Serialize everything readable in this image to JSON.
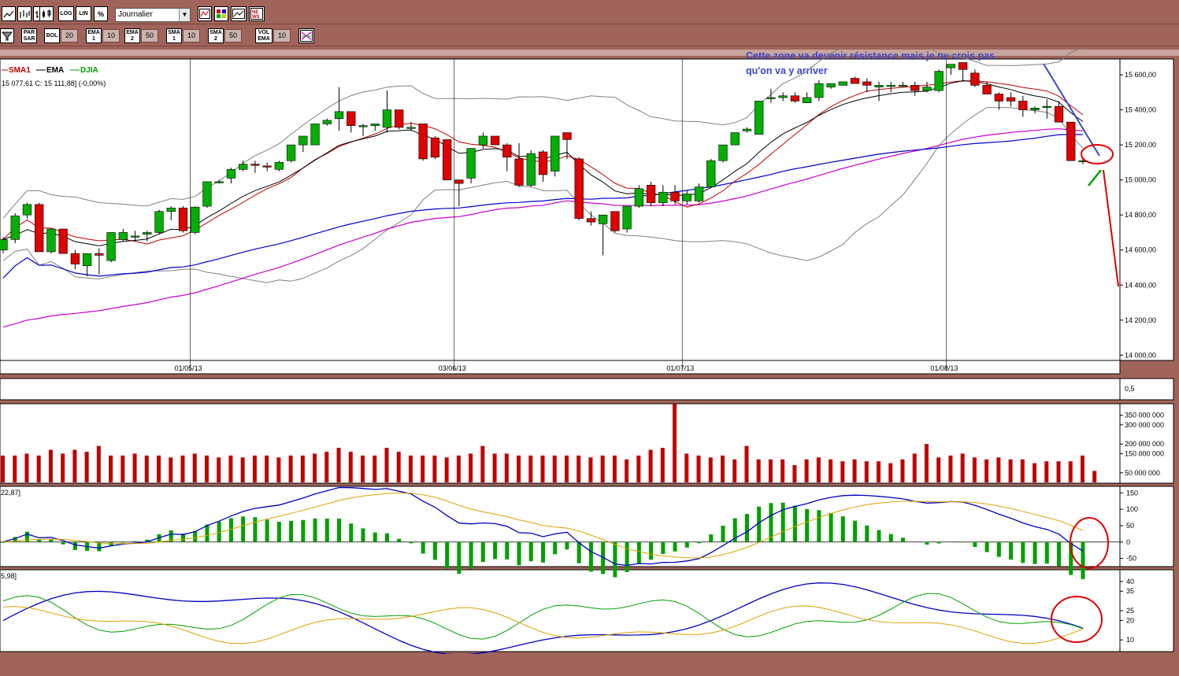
{
  "toolbar1": {
    "buttons": [
      {
        "id": "line-chart-button",
        "label": ""
      },
      {
        "id": "bar-chart-button",
        "label": ""
      },
      {
        "id": "ohlc-chart-button",
        "label": ""
      },
      {
        "id": "candle-chart-button",
        "label": ""
      },
      {
        "id": "log-button",
        "label": "LOG"
      },
      {
        "id": "lin-button",
        "label": "LIN"
      },
      {
        "id": "percent-button",
        "label": "%"
      }
    ],
    "period_select": "Journalier"
  },
  "toolbar2": {
    "indicators": [
      {
        "label": "PAR SAR",
        "value": ""
      },
      {
        "label": "BOL",
        "value": "20"
      },
      {
        "label": "EMA 1",
        "value": "10"
      },
      {
        "label": "EMA 2",
        "value": "50"
      },
      {
        "label": "SMA 1",
        "value": "10"
      },
      {
        "label": "SMA 2",
        "value": "50"
      },
      {
        "label": "VOL EMA",
        "value": "10"
      }
    ]
  },
  "legend": {
    "sma": "SMA1",
    "ema": "EMA",
    "djia": "DJIA"
  },
  "price_info": "15 077,61  C: 15 111,88] (-0,00%)",
  "annotation": {
    "line1": "Cette zone va devenir résistance mais je ne crois pas",
    "line2": "qu'on va y arriver"
  },
  "macd_info": "22,87]",
  "dmi_info": "5,98]",
  "colors": {
    "up": "#00b000",
    "down": "#e00000",
    "volume": "#c00000",
    "annotation": "#3a48c8",
    "ema50": "#cc00cc",
    "sma50": "#0000cc",
    "bollinger": "#808080"
  },
  "chart_data": {
    "type": "candlestick",
    "y_ticks": [
      "15 600,00",
      "15 400,00",
      "15 200,00",
      "15 000,00",
      "14 800,00",
      "14 600,00",
      "14 400,00",
      "14 200,00",
      "14 000,00"
    ],
    "ylim": [
      13970,
      15690
    ],
    "x_ticks": [
      {
        "label": "01/05/13",
        "index": 16
      },
      {
        "label": "03/06/13",
        "index": 38
      },
      {
        "label": "01/07/13",
        "index": 57
      },
      {
        "label": "01/08/13",
        "index": 79
      }
    ],
    "candles": [
      [
        14600,
        14675,
        14580,
        14660
      ],
      [
        14660,
        14810,
        14640,
        14795
      ],
      [
        14800,
        14870,
        14780,
        14860
      ],
      [
        14860,
        14870,
        14590,
        14590
      ],
      [
        14590,
        14720,
        14580,
        14720
      ],
      [
        14720,
        14720,
        14580,
        14580
      ],
      [
        14580,
        14600,
        14490,
        14520
      ],
      [
        14510,
        14580,
        14450,
        14580
      ],
      [
        14580,
        14610,
        14460,
        14570
      ],
      [
        14540,
        14700,
        14530,
        14700
      ],
      [
        14660,
        14720,
        14650,
        14700
      ],
      [
        14680,
        14710,
        14650,
        14680
      ],
      [
        14690,
        14710,
        14650,
        14700
      ],
      [
        14700,
        14830,
        14690,
        14820
      ],
      [
        14820,
        14850,
        14770,
        14840
      ],
      [
        14840,
        14850,
        14700,
        14710
      ],
      [
        14700,
        14850,
        14690,
        14845
      ],
      [
        14850,
        14980,
        14840,
        14990
      ],
      [
        14990,
        15000,
        14980,
        14990
      ],
      [
        15010,
        15070,
        14980,
        15060
      ],
      [
        15060,
        15110,
        15050,
        15090
      ],
      [
        15090,
        15110,
        15040,
        15085
      ],
      [
        15080,
        15100,
        15050,
        15075
      ],
      [
        15060,
        15110,
        15050,
        15100
      ],
      [
        15110,
        15190,
        15100,
        15200
      ],
      [
        15200,
        15230,
        15160,
        15250
      ],
      [
        15200,
        15320,
        15200,
        15320
      ],
      [
        15320,
        15350,
        15310,
        15340
      ],
      [
        15350,
        15530,
        15280,
        15390
      ],
      [
        15390,
        15370,
        15270,
        15310
      ],
      [
        15310,
        15320,
        15250,
        15310
      ],
      [
        15310,
        15320,
        15280,
        15320
      ],
      [
        15300,
        15510,
        15270,
        15400
      ],
      [
        15400,
        15400,
        15290,
        15300
      ],
      [
        15300,
        15330,
        15280,
        15300
      ],
      [
        15320,
        15320,
        15110,
        15120
      ],
      [
        15240,
        15250,
        15120,
        15130
      ],
      [
        15230,
        15230,
        15000,
        15000
      ],
      [
        15000,
        15000,
        14850,
        14980
      ],
      [
        15010,
        15180,
        14980,
        15180
      ],
      [
        15200,
        15270,
        15180,
        15250
      ],
      [
        15250,
        15250,
        15200,
        15200
      ],
      [
        15200,
        15210,
        15050,
        15130
      ],
      [
        15120,
        15210,
        14960,
        14970
      ],
      [
        14970,
        15170,
        14960,
        15150
      ],
      [
        15160,
        15170,
        14990,
        15030
      ],
      [
        15050,
        15230,
        15020,
        15250
      ],
      [
        15270,
        15270,
        15120,
        15230
      ],
      [
        15120,
        15130,
        14770,
        14780
      ],
      [
        14780,
        14820,
        14740,
        14760
      ],
      [
        14750,
        14800,
        14570,
        14800
      ],
      [
        14820,
        14800,
        14700,
        14710
      ],
      [
        14720,
        14850,
        14700,
        14850
      ],
      [
        14850,
        14970,
        14840,
        14950
      ],
      [
        14970,
        14990,
        14850,
        14870
      ],
      [
        14870,
        14970,
        14850,
        14930
      ],
      [
        14930,
        14970,
        14860,
        14880
      ],
      [
        14880,
        14940,
        14860,
        14920
      ],
      [
        14880,
        14980,
        14870,
        14960
      ],
      [
        14960,
        15120,
        14960,
        15110
      ],
      [
        15110,
        15200,
        15100,
        15200
      ],
      [
        15200,
        15270,
        15200,
        15270
      ],
      [
        15280,
        15300,
        15270,
        15290
      ],
      [
        15260,
        15400,
        15260,
        15450
      ],
      [
        15470,
        15520,
        15440,
        15470
      ],
      [
        15470,
        15500,
        15450,
        15480
      ],
      [
        15480,
        15500,
        15440,
        15450
      ],
      [
        15440,
        15500,
        15440,
        15470
      ],
      [
        15470,
        15570,
        15450,
        15550
      ],
      [
        15530,
        15550,
        15520,
        15550
      ],
      [
        15540,
        15560,
        15540,
        15560
      ],
      [
        15580,
        15590,
        15560,
        15550
      ],
      [
        15560,
        15580,
        15500,
        15540
      ],
      [
        15530,
        15560,
        15450,
        15540
      ],
      [
        15540,
        15560,
        15500,
        15540
      ],
      [
        15540,
        15560,
        15530,
        15540
      ],
      [
        15540,
        15560,
        15480,
        15510
      ],
      [
        15510,
        15560,
        15500,
        15530
      ],
      [
        15510,
        15630,
        15500,
        15620
      ],
      [
        15640,
        15660,
        15600,
        15660
      ],
      [
        15670,
        15660,
        15560,
        15630
      ],
      [
        15610,
        15630,
        15530,
        15540
      ],
      [
        15540,
        15560,
        15490,
        15490
      ],
      [
        15490,
        15500,
        15400,
        15450
      ],
      [
        15470,
        15500,
        15420,
        15450
      ],
      [
        15450,
        15480,
        15360,
        15400
      ],
      [
        15400,
        15420,
        15380,
        15410
      ],
      [
        15420,
        15460,
        15350,
        15420
      ],
      [
        15420,
        15450,
        15330,
        15330
      ],
      [
        15330,
        15330,
        15120,
        15110
      ],
      [
        15110,
        15120,
        15090,
        15110
      ]
    ],
    "volume_ticks": [
      "350 000 000",
      "300 000 000",
      "200 000 000",
      "150 000 000",
      "50 000 000"
    ],
    "volume_ylim": [
      0,
      410
    ],
    "volume": [
      140,
      140,
      150,
      140,
      170,
      150,
      170,
      160,
      190,
      140,
      140,
      150,
      140,
      140,
      130,
      140,
      150,
      140,
      130,
      140,
      130,
      140,
      140,
      130,
      140,
      140,
      150,
      160,
      180,
      160,
      140,
      140,
      180,
      160,
      140,
      140,
      140,
      130,
      140,
      150,
      190,
      150,
      150,
      140,
      140,
      140,
      140,
      140,
      140,
      130,
      140,
      140,
      120,
      140,
      170,
      180,
      410,
      150,
      140,
      130,
      140,
      120,
      190,
      120,
      120,
      120,
      90,
      120,
      130,
      120,
      110,
      120,
      110,
      110,
      100,
      120,
      150,
      200,
      130,
      140,
      150,
      130,
      120,
      130,
      120,
      120,
      100,
      110,
      110,
      110,
      140,
      60
    ],
    "macd_ticks": [
      "150",
      "100",
      "50",
      "0",
      "-50"
    ],
    "macd_ylim": [
      -75,
      170
    ],
    "dmi_ticks": [
      "40",
      "35",
      "25",
      "20",
      "10"
    ],
    "dmi_ylim": [
      4,
      46
    ],
    "osc_ticks": [
      "0,5"
    ]
  }
}
